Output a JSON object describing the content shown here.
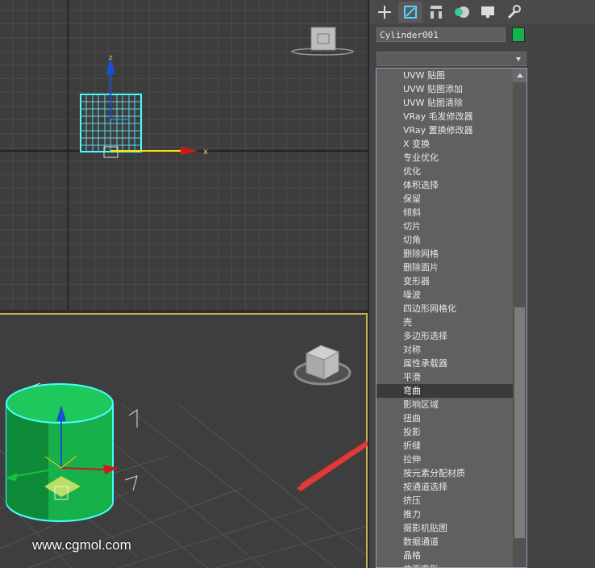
{
  "viewport_front": {
    "axis_label": "x",
    "axis_z": "z"
  },
  "viewport_persp": {},
  "command_panel": {
    "tabs": [
      {
        "icon": "plus-icon"
      },
      {
        "icon": "modify-icon"
      },
      {
        "icon": "hierarchy-icon"
      },
      {
        "icon": "motion-icon"
      },
      {
        "icon": "display-icon"
      },
      {
        "icon": "utilities-icon"
      }
    ],
    "object_name": "Cylinder001",
    "object_color": "#15b34a",
    "modifier_list": {
      "items": [
        "UVW 贴图",
        "UVW 贴图添加",
        "UVW 贴图清除",
        "VRay 毛发修改器",
        "VRay 置换修改器",
        "X 变换",
        "专业优化",
        "优化",
        "体积选择",
        "保留",
        "倾斜",
        "切片",
        "切角",
        "删除网格",
        "删除面片",
        "变形器",
        "噪波",
        "四边形网格化",
        "壳",
        "多边形选择",
        "对称",
        "属性承载器",
        "平滑",
        "弯曲",
        "影响区域",
        "扭曲",
        "投影",
        "折缝",
        "拉伸",
        "按元素分配材质",
        "按通道选择",
        "挤压",
        "推力",
        "摄影机贴图",
        "数据通道",
        "晶格",
        "曲面变形"
      ],
      "selected_index": 23
    }
  },
  "watermark": "www.cgmol.com"
}
